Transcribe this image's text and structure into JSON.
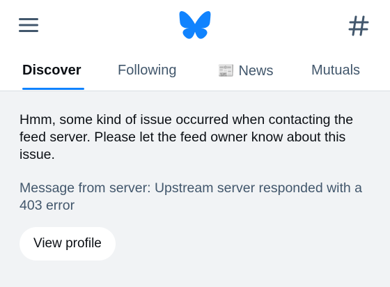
{
  "header": {
    "menu_icon": "hamburger-menu-icon",
    "logo_icon": "butterfly-logo-icon",
    "feeds_icon": "hashtag-icon",
    "accent_color": "#1083fe"
  },
  "tabs": [
    {
      "label": "Discover",
      "active": true
    },
    {
      "label": "Following",
      "active": false
    },
    {
      "label": "📰 News",
      "active": false
    },
    {
      "label": "Mutuals",
      "active": false
    }
  ],
  "error": {
    "message": "Hmm, some kind of issue occurred when contacting the feed server. Please let the feed owner know about this issue.",
    "server_message": "Message from server: Upstream server responded with a 403 error",
    "button_label": "View profile"
  }
}
